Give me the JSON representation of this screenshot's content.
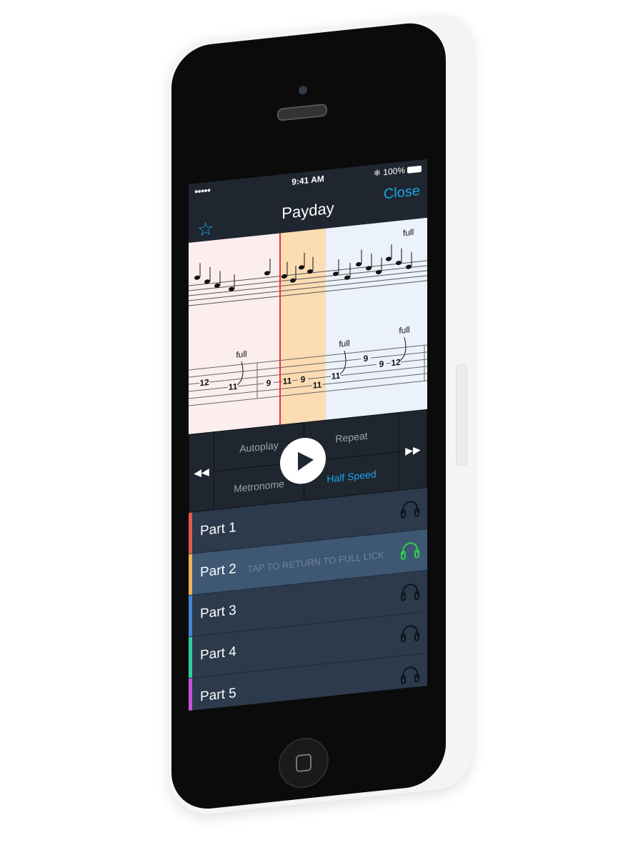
{
  "status": {
    "signal": "●●●●●",
    "time": "9:41 AM",
    "battery": "100%"
  },
  "nav": {
    "title": "Payday",
    "close": "Close",
    "star_icon": "star-icon"
  },
  "sheet": {
    "section_colors": [
      "#fdeeee",
      "#fbdcb3",
      "#ebf2fb"
    ],
    "playhead_color": "#e8343a",
    "bend_label": "full",
    "tab_notes": [
      {
        "string": 3,
        "fret": "12"
      },
      {
        "string": 4,
        "fret": "11",
        "bend": "full"
      },
      {
        "string": 4,
        "fret": "9"
      },
      {
        "string": 4,
        "fret": "11"
      },
      {
        "string": 4,
        "fret": "9"
      },
      {
        "string": 5,
        "fret": "11"
      },
      {
        "string": 4,
        "fret": "11",
        "bend": "full"
      },
      {
        "string": 2,
        "fret": "9"
      },
      {
        "string": 3,
        "fret": "9"
      },
      {
        "string": 3,
        "fret": "12",
        "bend": "full"
      }
    ]
  },
  "controls": {
    "autoplay": "Autoplay",
    "repeat": "Repeat",
    "metronome": "Metronome",
    "half_speed": "Half Speed",
    "accent": "#1aa6e4"
  },
  "parts": [
    {
      "name": "Part 1",
      "color": "#e65a4e",
      "active": false
    },
    {
      "name": "Part 2",
      "color": "#f0b35a",
      "active": true,
      "hint": "TAP TO RETURN TO FULL LICK",
      "headphone_color": "#2fd14a"
    },
    {
      "name": "Part 3",
      "color": "#3f86d8",
      "active": false
    },
    {
      "name": "Part 4",
      "color": "#2fcfa4",
      "active": false
    },
    {
      "name": "Part 5",
      "color": "#c653d6",
      "active": false
    }
  ]
}
